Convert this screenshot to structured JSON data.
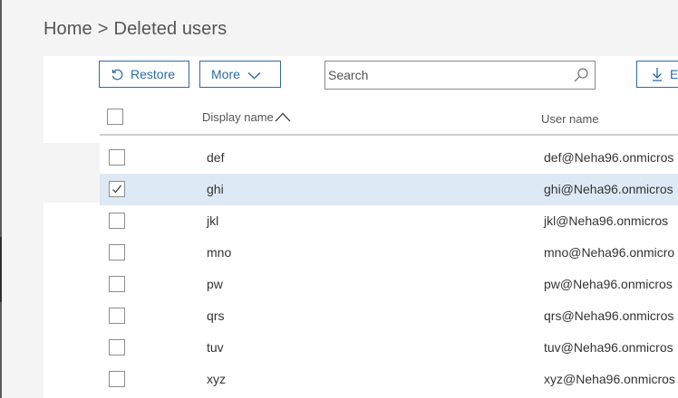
{
  "breadcrumb": {
    "home": "Home",
    "separator": ">",
    "current": "Deleted users"
  },
  "toolbar": {
    "restore_label": "Restore",
    "more_label": "More",
    "export_label": "E"
  },
  "search": {
    "placeholder": "Search",
    "value": ""
  },
  "table": {
    "headers": {
      "display_name": "Display name",
      "user_name": "User name"
    },
    "sort": {
      "column": "display_name",
      "direction": "ascending"
    },
    "rows": [
      {
        "display_name": "def",
        "user_name": "def@Neha96.onmicros",
        "checked": false
      },
      {
        "display_name": "ghi",
        "user_name": "ghi@Neha96.onmicros",
        "checked": true
      },
      {
        "display_name": "jkl",
        "user_name": "jkl@Neha96.onmicros",
        "checked": false
      },
      {
        "display_name": "mno",
        "user_name": "mno@Neha96.onmicro",
        "checked": false
      },
      {
        "display_name": "pw",
        "user_name": "pw@Neha96.onmicros",
        "checked": false
      },
      {
        "display_name": "qrs",
        "user_name": "qrs@Neha96.onmicros",
        "checked": false
      },
      {
        "display_name": "tuv",
        "user_name": "tuv@Neha96.onmicros",
        "checked": false
      },
      {
        "display_name": "xyz",
        "user_name": "xyz@Neha96.onmicros",
        "checked": false
      }
    ]
  },
  "icons": {
    "restore": "restore-icon",
    "more": "chevron-down-icon",
    "search": "search-icon",
    "export": "download-icon",
    "sort": "sort-ascending-icon",
    "check": "checkmark-icon"
  },
  "colors": {
    "accent": "#2b6aa8",
    "selected_row": "#dde9f4",
    "page_background": "#f4f4f4"
  }
}
